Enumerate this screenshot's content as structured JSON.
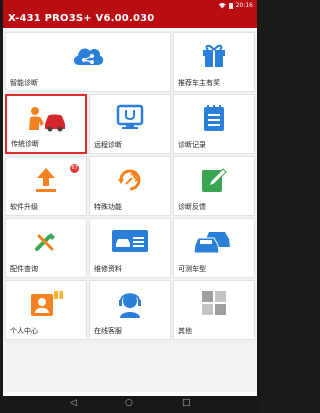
{
  "statusbar": {
    "time": "20:16"
  },
  "app": {
    "title": "X-431 PRO3S+ V6.00.030"
  },
  "tiles": [
    {
      "label": "智能诊断"
    },
    {
      "label": "推荐车主有奖"
    },
    {
      "label": "传统诊断"
    },
    {
      "label": "远程诊断"
    },
    {
      "label": "诊断记录"
    },
    {
      "label": "软件升级",
      "badge": "67"
    },
    {
      "label": "特殊功能"
    },
    {
      "label": "诊断反馈"
    },
    {
      "label": "配件查询"
    },
    {
      "label": "维修资料"
    },
    {
      "label": "可测车型"
    },
    {
      "label": "个人中心"
    },
    {
      "label": "在线客服"
    },
    {
      "label": "其他"
    }
  ],
  "colors": {
    "brand_red": "#b90d12",
    "icon_blue": "#2a7fd8",
    "icon_orange": "#f58220",
    "selected_outline": "#e22a2a"
  },
  "icons": {
    "smart": "cloud-share-icon",
    "reward": "gift-icon",
    "traditional": "mechanic-car-icon",
    "remote": "stethoscope-screen-icon",
    "records": "notepad-icon",
    "upgrade": "upload-arrow-icon",
    "special": "wrench-refresh-icon",
    "feedback": "edit-pencil-icon",
    "parts": "parts-search-icon",
    "repair_info": "car-info-icon",
    "vehicles": "cars-icon",
    "personal": "profile-card-icon",
    "support": "headset-agent-icon",
    "other": "grid-tiles-icon"
  }
}
